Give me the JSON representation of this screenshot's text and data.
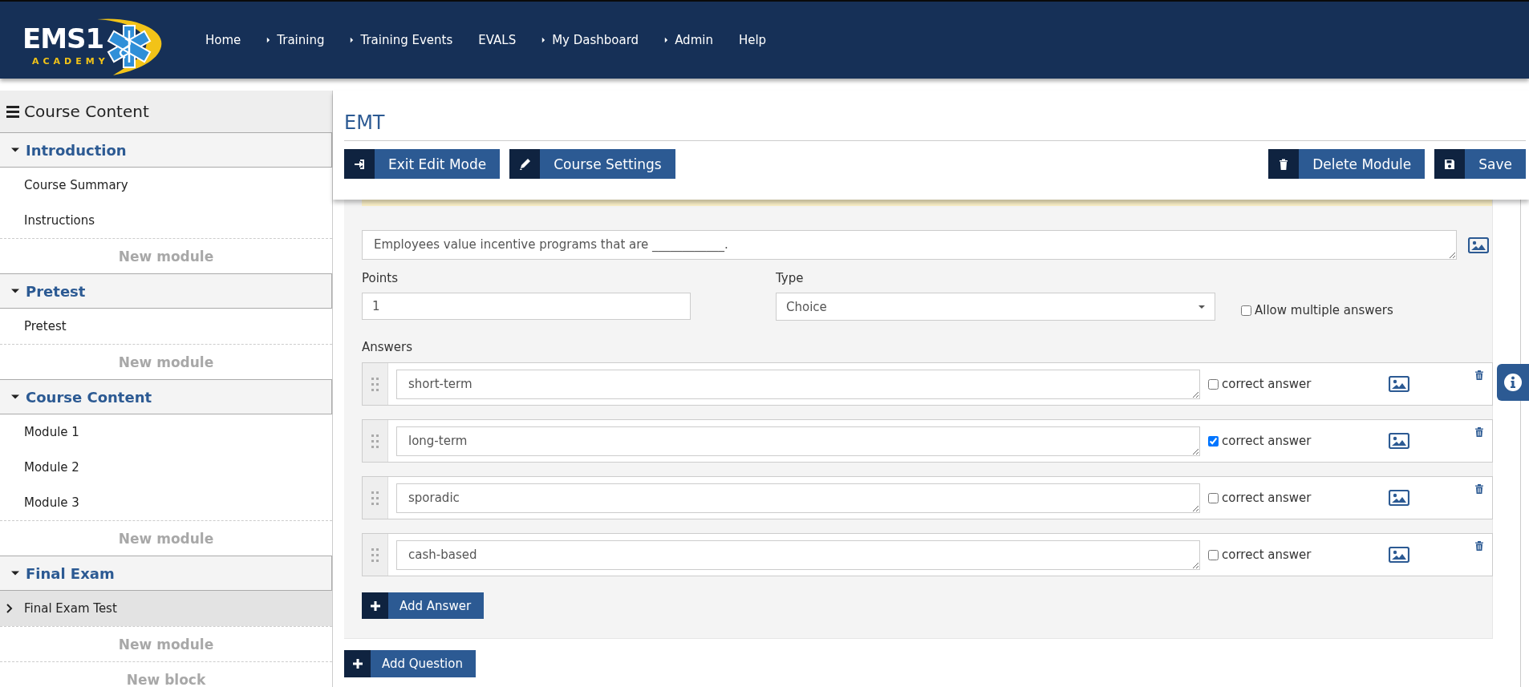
{
  "header": {
    "logo": {
      "title": "EMS1",
      "subtitle": "ACADEMY"
    },
    "nav": [
      {
        "label": "Home",
        "has_menu": false
      },
      {
        "label": "Training",
        "has_menu": true
      },
      {
        "label": "Training Events",
        "has_menu": true
      },
      {
        "label": "EVALS",
        "has_menu": false
      },
      {
        "label": "My Dashboard",
        "has_menu": true
      },
      {
        "label": "Admin",
        "has_menu": true
      },
      {
        "label": "Help",
        "has_menu": false
      }
    ]
  },
  "sidebar": {
    "title": "Course Content",
    "sections": [
      {
        "title": "Introduction",
        "expanded": true,
        "items": [
          {
            "label": "Course Summary",
            "selected": false
          },
          {
            "label": "Instructions",
            "selected": false
          }
        ],
        "add_label": "New module"
      },
      {
        "title": "Pretest",
        "expanded": true,
        "items": [
          {
            "label": "Pretest",
            "selected": false
          }
        ],
        "add_label": "New module"
      },
      {
        "title": "Course Content",
        "expanded": true,
        "items": [
          {
            "label": "Module 1",
            "selected": false
          },
          {
            "label": "Module 2",
            "selected": false
          },
          {
            "label": "Module 3",
            "selected": false
          }
        ],
        "add_label": "New module"
      },
      {
        "title": "Final Exam",
        "expanded": true,
        "items": [
          {
            "label": "Final Exam Test",
            "selected": true
          }
        ],
        "add_label": "New module"
      }
    ],
    "add_block_label": "New block"
  },
  "page": {
    "title": "EMT",
    "toolbar_left": [
      {
        "label": "Exit Edit Mode"
      },
      {
        "label": "Course Settings"
      }
    ],
    "toolbar_right": [
      {
        "label": "Delete Module"
      },
      {
        "label": "Save"
      }
    ]
  },
  "question": {
    "text": "Employees value incentive programs that are ____________.",
    "points_label": "Points",
    "points": "1",
    "type_label": "Type",
    "type": "Choice",
    "allow_multiple": {
      "label": "Allow multiple answers",
      "checked": false
    },
    "answers_label": "Answers",
    "answers": [
      {
        "text": "short-term",
        "correct": false,
        "correct_label": "correct answer"
      },
      {
        "text": "long-term",
        "correct": true,
        "correct_label": "correct answer"
      },
      {
        "text": "sporadic",
        "correct": false,
        "correct_label": "correct answer"
      },
      {
        "text": "cash-based",
        "correct": false,
        "correct_label": "correct answer"
      }
    ],
    "add_answer": "Add Answer"
  },
  "add_question": "Add Question"
}
